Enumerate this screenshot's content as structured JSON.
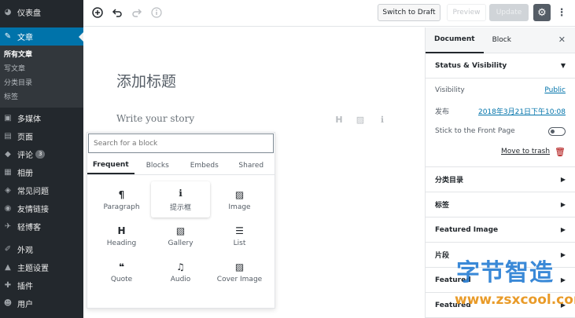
{
  "sidebar": {
    "items": [
      {
        "icon": "dashboard-icon",
        "glyph": "◕",
        "label": "仪表盘"
      },
      {
        "icon": "pin-icon",
        "glyph": "✎",
        "label": "文章",
        "active": true
      },
      {
        "icon": "media-icon",
        "glyph": "▣",
        "label": "多媒体"
      },
      {
        "icon": "page-icon",
        "glyph": "▤",
        "label": "页面"
      },
      {
        "icon": "comment-icon",
        "glyph": "◆",
        "label": "评论",
        "badge": "3"
      },
      {
        "icon": "album-icon",
        "glyph": "▦",
        "label": "相册"
      },
      {
        "icon": "faq-icon",
        "glyph": "◈",
        "label": "常见问题"
      },
      {
        "icon": "links-icon",
        "glyph": "◉",
        "label": "友情链接"
      },
      {
        "icon": "microblog-icon",
        "glyph": "✈",
        "label": "轻博客"
      },
      {
        "icon": "appearance-icon",
        "glyph": "✐",
        "label": "外观"
      },
      {
        "icon": "theme-settings-icon",
        "glyph": "▲",
        "label": "主题设置"
      },
      {
        "icon": "plugins-icon",
        "glyph": "✚",
        "label": "插件"
      },
      {
        "icon": "users-icon",
        "glyph": "☻",
        "label": "用户"
      }
    ],
    "submenu": [
      "所有文章",
      "写文章",
      "分类目录",
      "标签"
    ]
  },
  "toolbar": {
    "switch_to_draft": "Switch to Draft",
    "preview": "Preview",
    "update": "Update"
  },
  "editor": {
    "title": "添加标题",
    "write_story": "Write your story"
  },
  "inserter": {
    "search_placeholder": "Search for a block",
    "tabs": [
      "Frequent",
      "Blocks",
      "Embeds",
      "Shared"
    ],
    "blocks": [
      {
        "glyph": "¶",
        "label": "Paragraph"
      },
      {
        "glyph": "ℹ",
        "label": "提示框"
      },
      {
        "glyph": "▨",
        "label": "Image"
      },
      {
        "glyph": "H",
        "label": "Heading"
      },
      {
        "glyph": "▧",
        "label": "Gallery"
      },
      {
        "glyph": "☰",
        "label": "List"
      },
      {
        "glyph": "❝",
        "label": "Quote"
      },
      {
        "glyph": "♫",
        "label": "Audio"
      },
      {
        "glyph": "▨",
        "label": "Cover Image"
      }
    ]
  },
  "settings": {
    "tabs": [
      "Document",
      "Block"
    ],
    "status_visibility": {
      "heading": "Status & Visibility",
      "visibility_label": "Visibility",
      "visibility_value": "Public",
      "publish_label": "发布",
      "publish_value": "2018年3月21日下午10:08",
      "sticky_label": "Stick to the Front Page",
      "trash_label": "Move to trash"
    },
    "panels": [
      "分类目录",
      "标签",
      "Featured Image",
      "片段",
      "Featured",
      "Featured"
    ]
  },
  "watermark": {
    "chinese": "字节智造",
    "url": "www.zsxcool.com"
  }
}
